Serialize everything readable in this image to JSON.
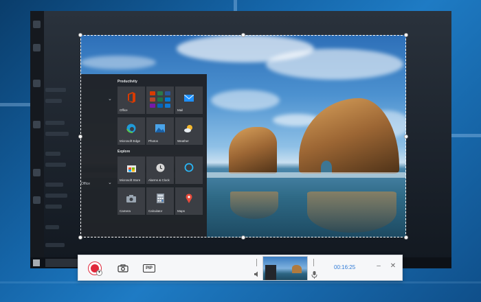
{
  "start_menu": {
    "group_productivity": "Productivity",
    "group_explore": "Explore",
    "list_items": [
      "Office"
    ],
    "tiles_productivity": [
      {
        "label": "Office",
        "icon": "office-icon",
        "color": "#d83b01"
      },
      {
        "label": "",
        "icon": "office-apps-icon",
        "color": "#2b579a"
      },
      {
        "label": "Mail",
        "icon": "mail-icon",
        "color": "#1e90ff"
      },
      {
        "label": "Microsoft Edge",
        "icon": "edge-icon",
        "color": "#1f9bd9"
      },
      {
        "label": "Photos",
        "icon": "photos-icon",
        "color": "#4aa3e8"
      },
      {
        "label": "Weather",
        "icon": "weather-icon",
        "color": "#f5b82e"
      }
    ],
    "tiles_explore": [
      {
        "label": "Microsoft Store",
        "icon": "store-icon",
        "color": "#4a4f57"
      },
      {
        "label": "Alarms & Clock",
        "icon": "alarm-clock-icon",
        "color": "#d9d9d9"
      },
      {
        "label": "",
        "icon": "cortana-icon",
        "color": "#29b6f6"
      },
      {
        "label": "Camera",
        "icon": "camera-icon",
        "color": "#9aa6b2"
      },
      {
        "label": "Calculator",
        "icon": "calculator-icon",
        "color": "#8a94a0"
      },
      {
        "label": "Maps",
        "icon": "maps-icon",
        "color": "#e84b3c"
      }
    ]
  },
  "toolbar": {
    "record_icon": "record-icon",
    "screenshot_icon": "camera-icon",
    "pip_label": "PIP",
    "speaker_icon": "speaker-icon",
    "mic_icon": "microphone-icon",
    "timer": "00:16:25",
    "minimize_label": "–",
    "close_label": "✕",
    "accent": "#2f7ad6",
    "record_color": "#e0283b"
  }
}
